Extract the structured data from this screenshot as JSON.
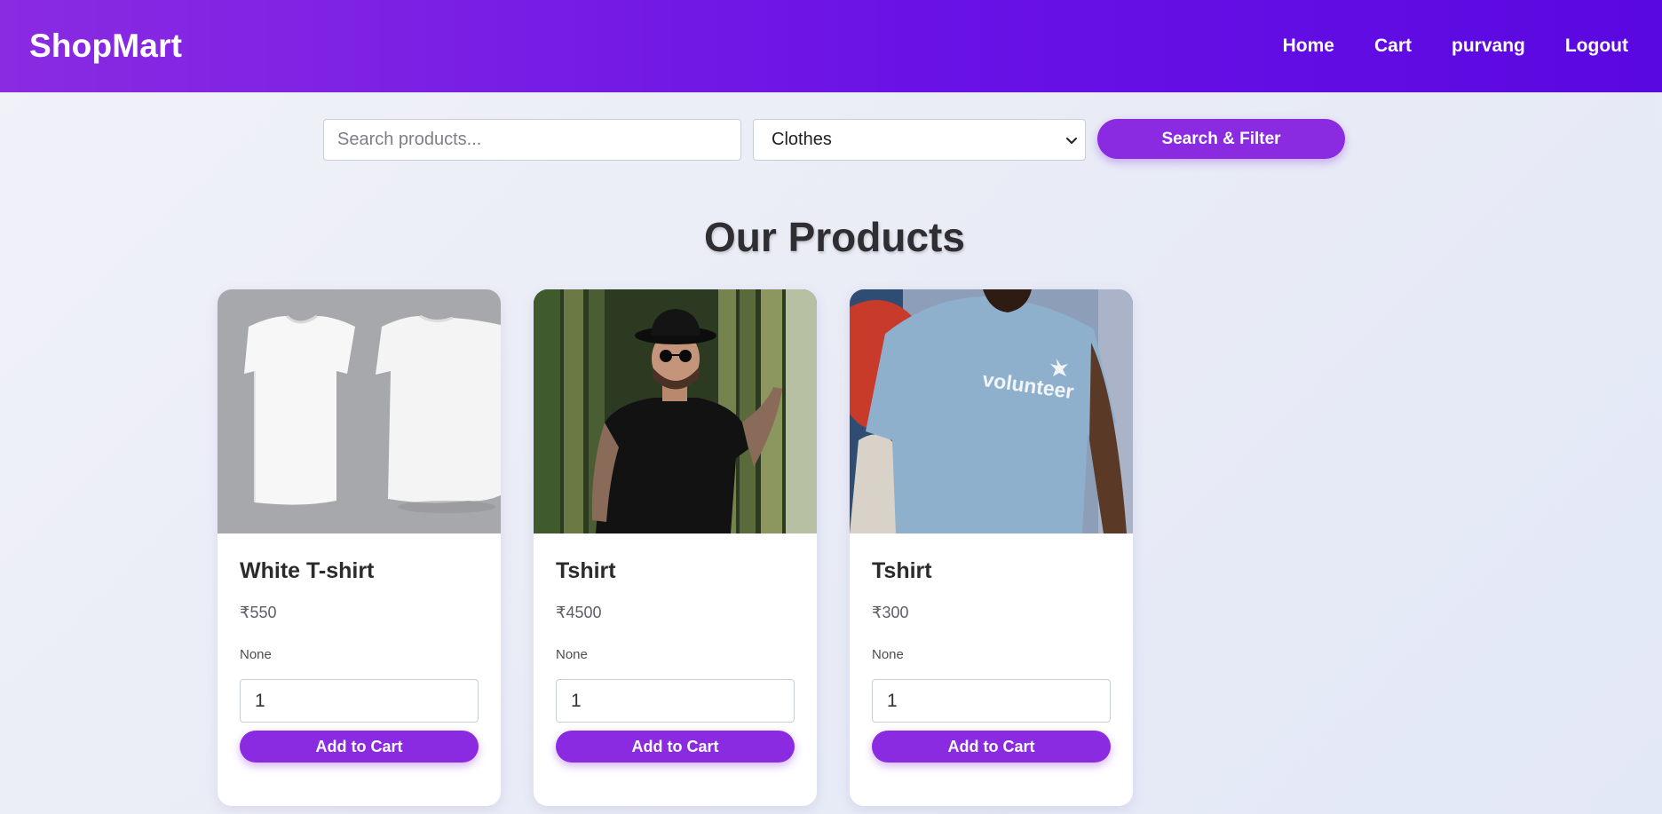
{
  "navbar": {
    "brand": "ShopMart",
    "links": [
      "Home",
      "Cart",
      "purvang",
      "Logout"
    ]
  },
  "filters": {
    "search_placeholder": "Search products...",
    "search_value": "",
    "category_selected": "Clothes",
    "button_label": "Search & Filter"
  },
  "main": {
    "title": "Our Products"
  },
  "products": [
    {
      "name": "White T-shirt",
      "price": "₹550",
      "description": "None",
      "quantity": "1",
      "button_label": "Add to Cart",
      "image": "white-tshirts-photo"
    },
    {
      "name": "Tshirt",
      "price": "₹4500",
      "description": "None",
      "quantity": "1",
      "button_label": "Add to Cart",
      "image": "man-in-black-tshirt-bamboo-photo"
    },
    {
      "name": "Tshirt",
      "price": "₹300",
      "description": "None",
      "quantity": "1",
      "button_label": "Add to Cart",
      "image": "man-in-volunteer-tshirt-photo"
    }
  ],
  "colors": {
    "accent": "#8a2be2",
    "navbar_end": "#5a08e0",
    "title_text": "#2f2f33"
  }
}
